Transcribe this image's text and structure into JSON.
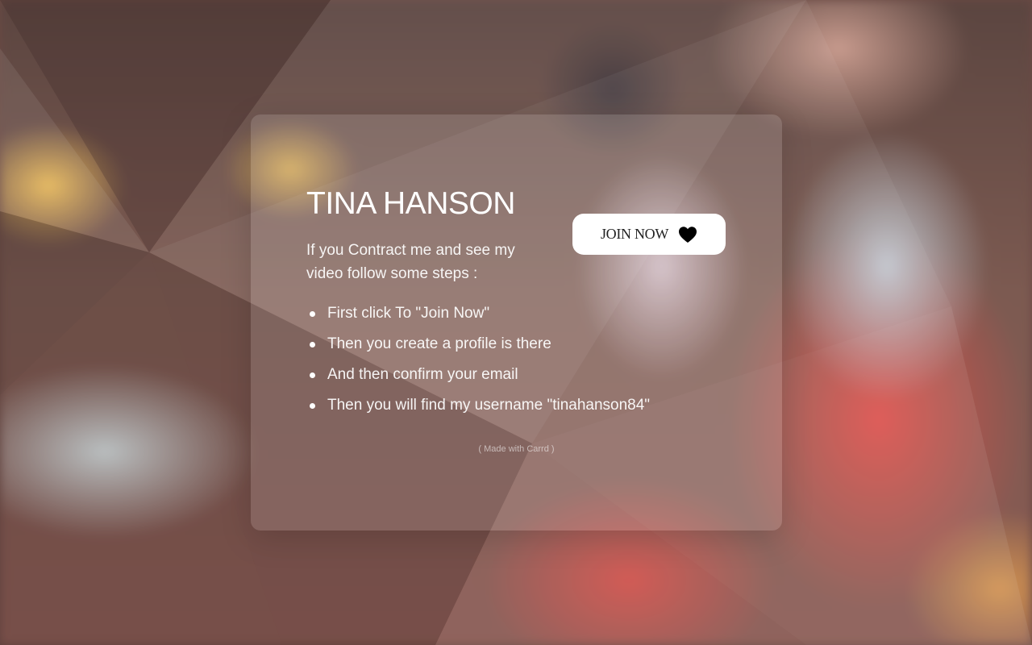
{
  "page": {
    "title": "TINA HANSON",
    "intro": "If you Contract me and see my video follow some steps :",
    "steps": [
      "First click To \"Join Now\"",
      "Then you create a profile is there",
      "And then confirm your email",
      "Then you will find my username \"tinahanson84\""
    ],
    "join_button": {
      "label": "JOIN NOW",
      "icon": "heart-icon"
    },
    "credit": "( Made with Carrd )"
  },
  "colors": {
    "card_background": "#ffffff",
    "text": "#ffffff",
    "button_background": "#ffffff",
    "button_text": "#222222"
  }
}
